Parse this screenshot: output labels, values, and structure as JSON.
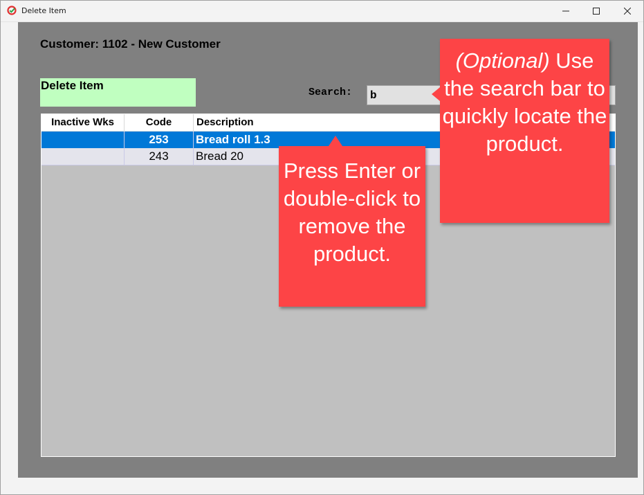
{
  "window": {
    "title": "Delete Item",
    "icon": "app-logo-icon",
    "controls": {
      "minimize": "minimize-icon",
      "maximize": "maximize-icon",
      "close": "close-icon"
    }
  },
  "header": {
    "customer_label": "Customer: 1102 - New Customer",
    "mode_label": "Delete Item",
    "mode_color": "#c0ffc0"
  },
  "search": {
    "label": "Search:",
    "value": "b"
  },
  "grid": {
    "columns": [
      "Inactive Wks",
      "Code",
      "Description"
    ],
    "rows": [
      {
        "inactive_wks": "",
        "code": "253",
        "description": "Bread roll 1.3",
        "selected": true
      },
      {
        "inactive_wks": "",
        "code": "243",
        "description": "Bread 20",
        "selected": false
      }
    ],
    "selection_color": "#0078d7"
  },
  "callouts": {
    "enter_tip": "Press Enter or double-click to remove the product.",
    "search_tip_italic": "(Optional)",
    "search_tip_rest": "Use the search bar to quickly locate the product.",
    "color": "#fd4446"
  }
}
